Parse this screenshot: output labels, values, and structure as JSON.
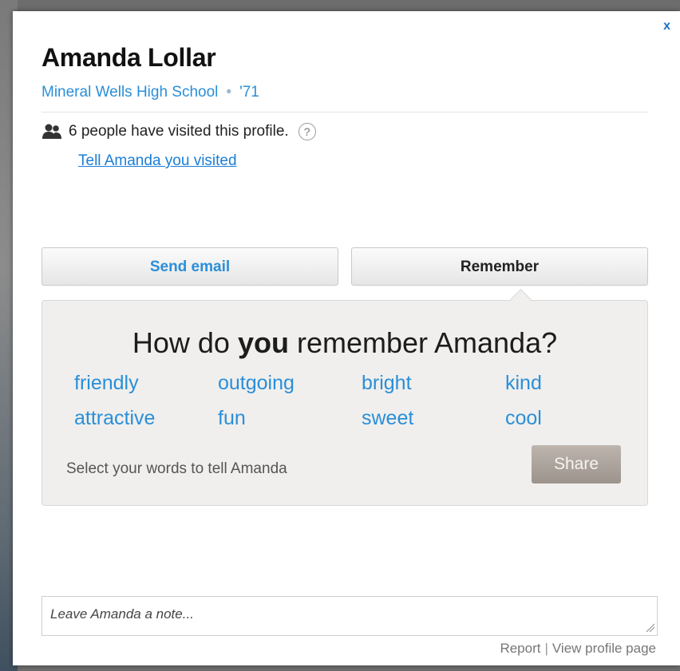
{
  "profile": {
    "name": "Amanda Lollar",
    "school": "Mineral Wells High School",
    "separator": "•",
    "year": "'71"
  },
  "close_label": "x",
  "visits": {
    "text": "6 people have visited this profile.",
    "help": "?",
    "tell_link": "Tell Amanda you visited"
  },
  "actions": {
    "send_email": "Send email",
    "remember": "Remember"
  },
  "remember_panel": {
    "question_prefix": "How do ",
    "question_bold": "you",
    "question_suffix": " remember Amanda?",
    "words": [
      "friendly",
      "outgoing",
      "bright",
      "kind",
      "attractive",
      "fun",
      "sweet",
      "cool"
    ],
    "hint": "Select your words to tell Amanda",
    "share": "Share"
  },
  "note": {
    "placeholder": "Leave Amanda a note..."
  },
  "footer": {
    "report": "Report",
    "separator": "|",
    "view_profile": "View profile page"
  },
  "icons": {
    "people": "people-icon",
    "help": "question-circle-icon",
    "close": "close-icon"
  },
  "colors": {
    "link_blue": "#2a8fd8",
    "share_button": "#a8a098",
    "panel_bg": "#f0efed"
  }
}
